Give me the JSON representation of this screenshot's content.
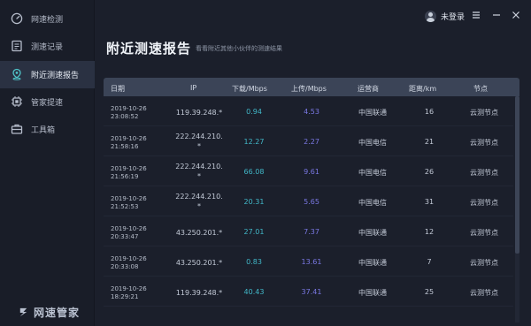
{
  "sidebar": {
    "items": [
      {
        "label": "网速检测",
        "icon": "speedometer-icon"
      },
      {
        "label": "测速记录",
        "icon": "document-icon"
      },
      {
        "label": "附近测速报告",
        "icon": "location-pin-icon"
      },
      {
        "label": "管家提速",
        "icon": "chip-icon"
      },
      {
        "label": "工具箱",
        "icon": "toolbox-icon"
      }
    ],
    "active_index": 2,
    "brand": "网速管家"
  },
  "topbar": {
    "login_label": "未登录",
    "menu_icon": "hamburger-menu-icon",
    "minimize_icon": "minimize-icon",
    "close_icon": "close-icon"
  },
  "page": {
    "title": "附近测速报告",
    "subtitle": "看看附近其他小伙伴的测速结果"
  },
  "table": {
    "headers": {
      "date": "日期",
      "ip": "IP",
      "download": "下载/Mbps",
      "upload": "上传/Mbps",
      "isp": "运营商",
      "distance": "距离/km",
      "node": "节点"
    },
    "rows": [
      {
        "date": "2019-10-26",
        "time": "23:08:52",
        "ip1": "119.39.248.*",
        "ip2": "",
        "down": "0.94",
        "up": "4.53",
        "isp": "中国联通",
        "dist": "16",
        "node": "云测节点"
      },
      {
        "date": "2019-10-26",
        "time": "21:58:16",
        "ip1": "222.244.210.",
        "ip2": "*",
        "down": "12.27",
        "up": "2.27",
        "isp": "中国电信",
        "dist": "21",
        "node": "云测节点"
      },
      {
        "date": "2019-10-26",
        "time": "21:56:19",
        "ip1": "222.244.210.",
        "ip2": "*",
        "down": "66.08",
        "up": "9.61",
        "isp": "中国电信",
        "dist": "26",
        "node": "云测节点"
      },
      {
        "date": "2019-10-26",
        "time": "21:52:53",
        "ip1": "222.244.210.",
        "ip2": "*",
        "down": "20.31",
        "up": "5.65",
        "isp": "中国电信",
        "dist": "31",
        "node": "云测节点"
      },
      {
        "date": "2019-10-26",
        "time": "20:33:47",
        "ip1": "43.250.201.*",
        "ip2": "",
        "down": "27.01",
        "up": "7.37",
        "isp": "中国联通",
        "dist": "12",
        "node": "云测节点"
      },
      {
        "date": "2019-10-26",
        "time": "20:33:08",
        "ip1": "43.250.201.*",
        "ip2": "",
        "down": "0.83",
        "up": "13.61",
        "isp": "中国联通",
        "dist": "7",
        "node": "云测节点"
      },
      {
        "date": "2019-10-26",
        "time": "18:29:21",
        "ip1": "119.39.248.*",
        "ip2": "",
        "down": "40.43",
        "up": "37.41",
        "isp": "中国联通",
        "dist": "25",
        "node": "云测节点"
      }
    ]
  },
  "colors": {
    "download": "#41b7c8",
    "upload": "#7a78e3",
    "active_nav": "#2a3142",
    "header_bg": "#3b4457"
  }
}
